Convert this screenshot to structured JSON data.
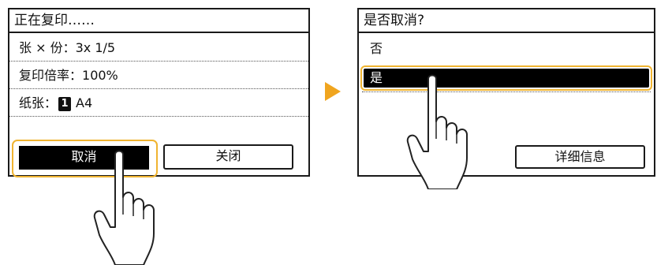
{
  "left_screen": {
    "title": "正在复印……",
    "rows": [
      {
        "label": "张 × 份：",
        "value": "3x  1/5"
      },
      {
        "label": "复印倍率：",
        "value": "100%"
      },
      {
        "label": "纸张：",
        "badge": "1",
        "value": "A4"
      }
    ],
    "cancel_label": "取消",
    "close_label": "关闭"
  },
  "right_screen": {
    "title": "是否取消?",
    "option_no": "否",
    "option_yes": "是",
    "details_label": "详细信息"
  },
  "colors": {
    "highlight": "#f0b431",
    "arrow": "#f0a51f",
    "selected_bg": "#000000"
  },
  "icons": [
    "next-arrow-icon",
    "hand-pointer-icon"
  ]
}
